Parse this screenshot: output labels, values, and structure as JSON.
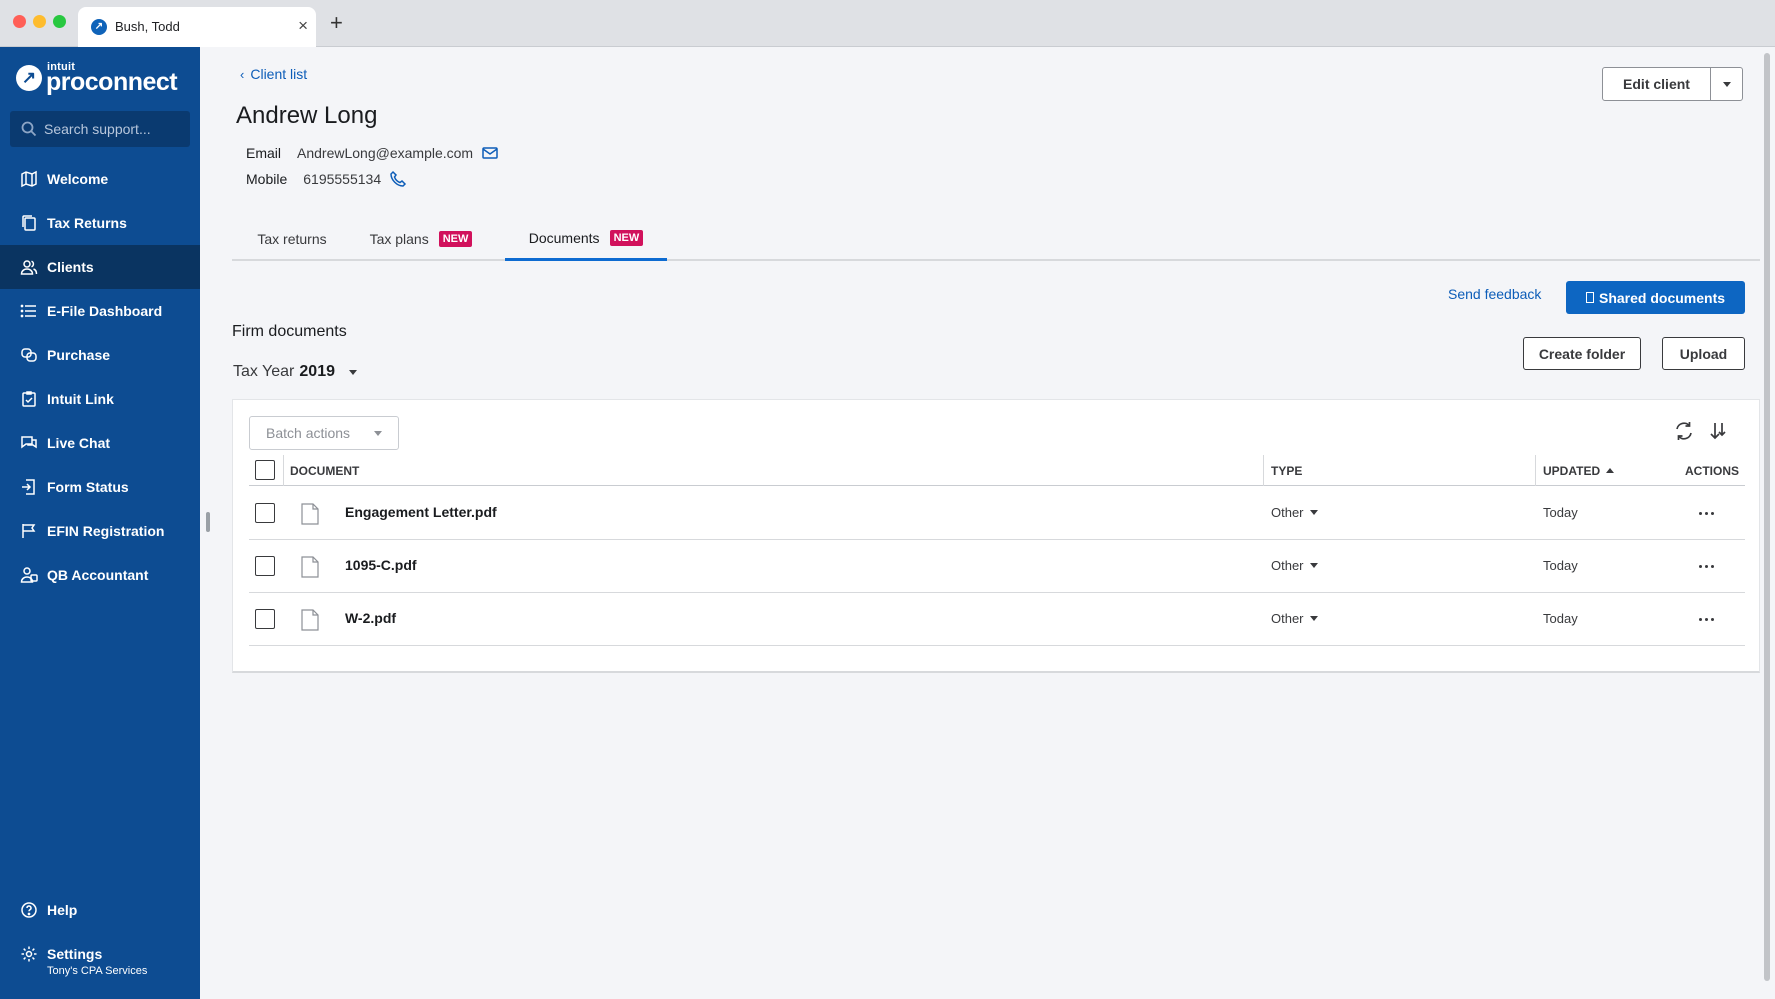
{
  "browser": {
    "tab_title": "Bush, Todd",
    "new_tab_label": "+",
    "close_label": "×"
  },
  "sidebar": {
    "logo_small": "intuit",
    "logo_main": "proconnect",
    "search_placeholder": "Search support...",
    "items": [
      {
        "label": "Welcome",
        "icon": "map-icon"
      },
      {
        "label": "Tax Returns",
        "icon": "copy-icon"
      },
      {
        "label": "Clients",
        "icon": "users-icon",
        "active": true
      },
      {
        "label": "E-File Dashboard",
        "icon": "list-icon"
      },
      {
        "label": "Purchase",
        "icon": "tag-icon"
      },
      {
        "label": "Intuit Link",
        "icon": "clipboard-check-icon"
      },
      {
        "label": "Live Chat",
        "icon": "chat-icon"
      },
      {
        "label": "Form Status",
        "icon": "form-arrow-icon"
      },
      {
        "label": "EFIN Registration",
        "icon": "flag-icon"
      },
      {
        "label": "QB Accountant",
        "icon": "accountant-icon"
      }
    ],
    "help_label": "Help",
    "settings_label": "Settings",
    "settings_sub": "Tony's CPA Services"
  },
  "header": {
    "back_label": "Client list",
    "client_name": "Andrew Long",
    "email_label": "Email",
    "email_value": "AndrewLong@example.com",
    "mobile_label": "Mobile",
    "mobile_value": "6195555134",
    "edit_button": "Edit client"
  },
  "tabs": [
    {
      "label": "Tax returns",
      "badge": ""
    },
    {
      "label": "Tax plans",
      "badge": "NEW"
    },
    {
      "label": "Documents",
      "badge": "NEW",
      "active": true
    }
  ],
  "documents": {
    "send_feedback": "Send feedback",
    "shared_documents": "Shared documents",
    "section_title": "Firm documents",
    "tax_year_label": "Tax Year",
    "tax_year_value": "2019",
    "create_folder": "Create folder",
    "upload": "Upload",
    "batch_actions": "Batch actions",
    "columns": {
      "document": "DOCUMENT",
      "type": "TYPE",
      "updated": "UPDATED",
      "actions": "ACTIONS"
    },
    "rows": [
      {
        "name": "Engagement Letter.pdf",
        "type": "Other",
        "updated": "Today"
      },
      {
        "name": "1095-C.pdf",
        "type": "Other",
        "updated": "Today"
      },
      {
        "name": "W-2.pdf",
        "type": "Other",
        "updated": "Today"
      }
    ]
  },
  "colors": {
    "sidebar_bg": "#0d4c92",
    "sidebar_active": "#0a3461",
    "primary_button": "#0d66c2",
    "link": "#0d5db8",
    "badge": "#d1115c"
  }
}
